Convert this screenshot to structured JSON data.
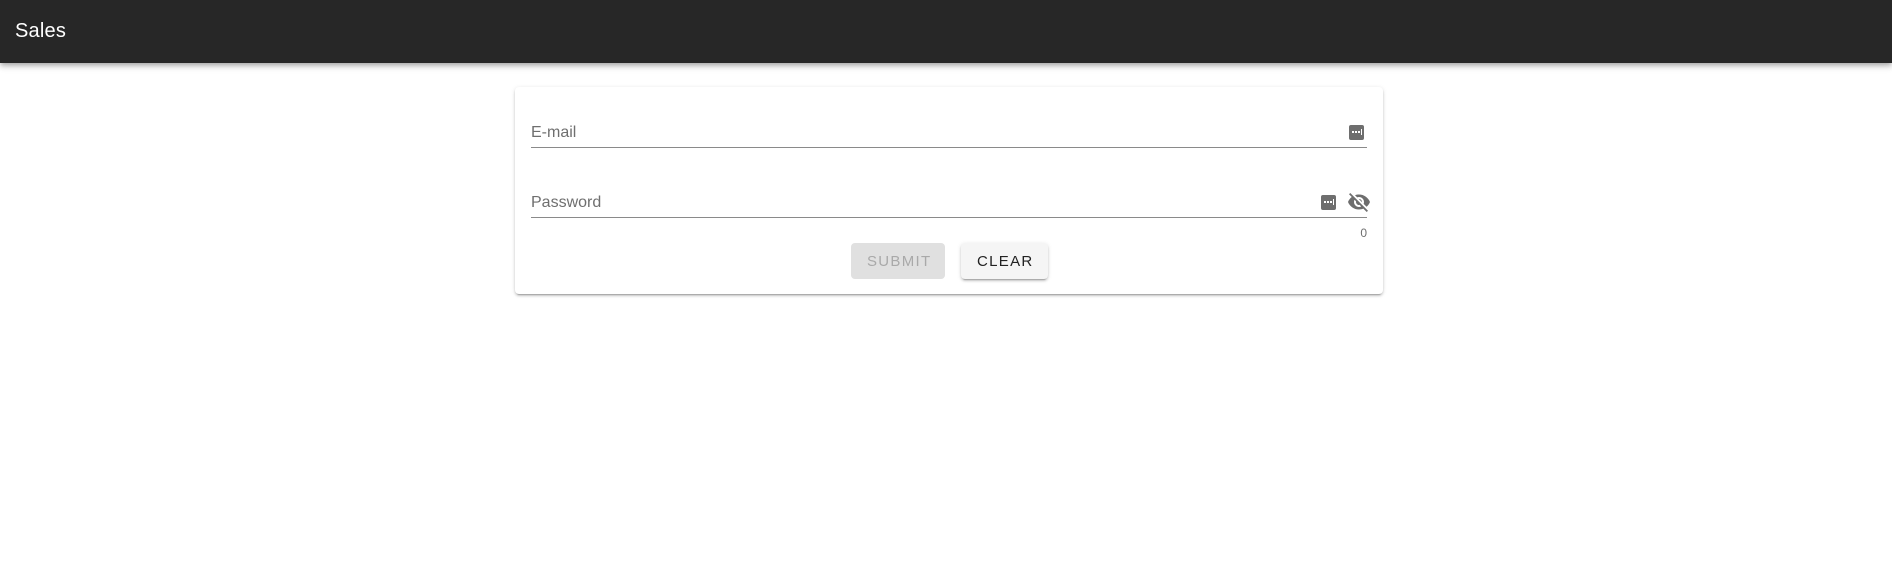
{
  "app_bar": {
    "title": "Sales",
    "background_color": "#272727"
  },
  "form": {
    "email": {
      "label": "E-mail",
      "value": "",
      "trailing_icon": "password-manager-icon"
    },
    "password": {
      "label": "Password",
      "value": "",
      "trailing_icon": "password-manager-icon",
      "visibility_icon": "eye-off-icon",
      "counter": "0"
    },
    "buttons": {
      "submit_label": "Submit",
      "clear_label": "Clear"
    }
  }
}
